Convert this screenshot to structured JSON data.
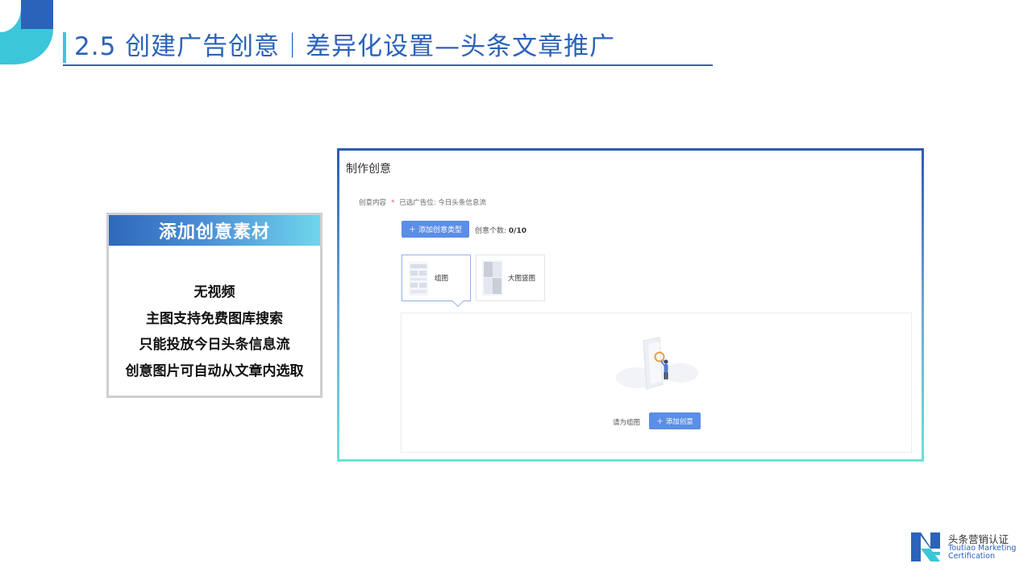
{
  "slide": {
    "title": "2.5 创建广告创意｜差异化设置—头条文章推广",
    "colors": {
      "primary": "#2b63b8",
      "accent": "#3cc6da",
      "button": "#5b8ee6"
    }
  },
  "info_card": {
    "header": "添加创意素材",
    "features": [
      "无视频",
      "主图支持免费图库搜索",
      "只能投放今日头条信息流",
      "创意图片可自动从文章内选取"
    ]
  },
  "screenshot": {
    "panel_title": "制作创意",
    "content_label": "创意内容",
    "required_mark": "*",
    "placement_text": "已选广告位: 今日头条信息流",
    "add_type_button": "添加创意类型",
    "count_label": "创意个数:",
    "count_value": "0/10",
    "type_cards": [
      {
        "label": "组图",
        "icon": "image-group-icon",
        "active": true
      },
      {
        "label": "大图竖图",
        "icon": "vertical-image-icon",
        "active": false
      }
    ],
    "empty_hint": "请为组图",
    "add_creative_button": "添加创意"
  },
  "footer": {
    "logo_cn": "头条营销认证",
    "logo_en_line1": "Toutiao Marketing",
    "logo_en_line2": "Certification"
  }
}
